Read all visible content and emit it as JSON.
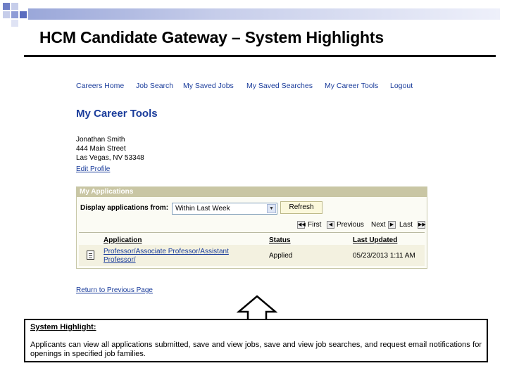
{
  "slide": {
    "title": "HCM Candidate Gateway – System Highlights",
    "accent_color": "#9aa7d9"
  },
  "nav": {
    "items": [
      "Careers Home",
      "Job Search",
      "My Saved Jobs",
      "My Saved Searches",
      "My Career Tools",
      "Logout"
    ]
  },
  "page": {
    "heading": "My Career Tools",
    "address": [
      "Jonathan Smith",
      "444 Main Street",
      "Las Vegas, NV 53348"
    ],
    "edit_profile": "Edit Profile",
    "return_link": "Return to Previous Page"
  },
  "applications": {
    "panel_title": "My Applications",
    "display_label": "Display applications from:",
    "filter_value": "Within Last Week",
    "refresh_label": "Refresh",
    "pager": {
      "first": "First",
      "previous": "Previous",
      "next": "Next",
      "last": "Last"
    },
    "columns": [
      "Application",
      "Status",
      "Last Updated"
    ],
    "rows": [
      {
        "application_line1": "Professor/Associate Professor/Assistant",
        "application_line2": "Professor/",
        "status": "Applied",
        "last_updated": "05/23/2013 1:11 AM"
      }
    ]
  },
  "highlight": {
    "title": "System Highlight:",
    "body": "Applicants can view all applications submitted, save and view jobs, save and view job searches, and request email notifications for openings in specified job families."
  }
}
